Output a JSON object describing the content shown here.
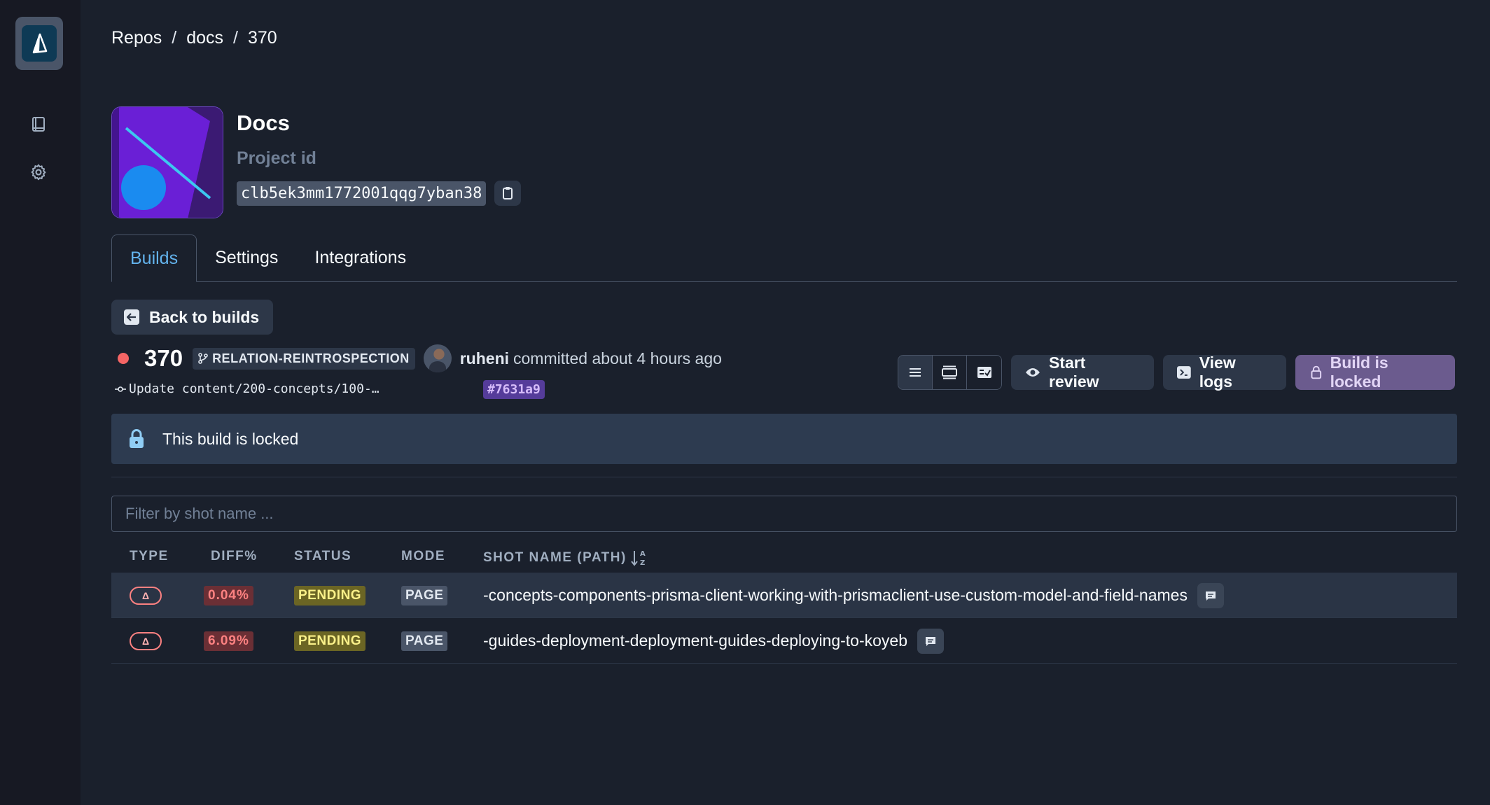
{
  "breadcrumb": [
    "Repos",
    "docs",
    "370"
  ],
  "project": {
    "name": "Docs",
    "id_label": "Project id",
    "id": "clb5ek3mm1772001qqg7yban38"
  },
  "tabs": [
    "Builds",
    "Settings",
    "Integrations"
  ],
  "back_label": "Back to builds",
  "build": {
    "number": "370",
    "branch": "RELATION-REINTROSPECTION",
    "user": "ruheni",
    "committed": "committed about 4 hours ago",
    "message": "Update content/200-concepts/100-…",
    "hash": "#7631a9",
    "status_color": "#f56565"
  },
  "toolbar": {
    "start_review": "Start review",
    "view_logs": "View logs",
    "locked": "Build is locked"
  },
  "locked_banner": "This build is locked",
  "filter_placeholder": "Filter by shot name ...",
  "table": {
    "headers": [
      "TYPE",
      "DIFF%",
      "STATUS",
      "MODE",
      "SHOT NAME (PATH)"
    ],
    "rows": [
      {
        "type": "Δ",
        "diff": "0.04%",
        "status": "PENDING",
        "mode": "PAGE",
        "name": "-concepts-components-prisma-client-working-with-prismaclient-use-custom-model-and-field-names"
      },
      {
        "type": "Δ",
        "diff": "6.09%",
        "status": "PENDING",
        "mode": "PAGE",
        "name": "-guides-deployment-deployment-guides-deploying-to-koyeb"
      }
    ]
  }
}
